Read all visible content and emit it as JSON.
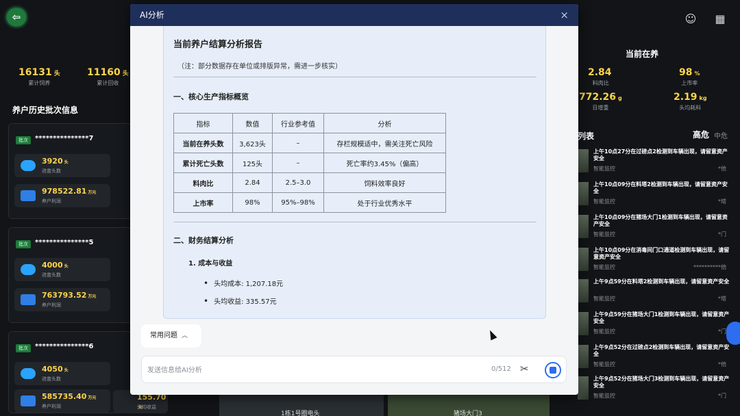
{
  "dashboard": {
    "left_stats": [
      {
        "value": "16131",
        "unit": "头",
        "label": "累计饲养"
      },
      {
        "value": "11160",
        "unit": "头",
        "label": "累计回收"
      }
    ],
    "history_title": "养户历史批次信息",
    "batch_tag": "批次",
    "batches": [
      {
        "name": "***************7",
        "intake": "3920",
        "intake_unit": "头",
        "intake_label": "进苗头数",
        "profit": "978522.81",
        "profit_unit": "万元",
        "profit_label": "养户利润"
      },
      {
        "name": "***************5",
        "intake": "4000",
        "intake_unit": "头",
        "intake_label": "进苗头数",
        "profit": "763793.52",
        "profit_unit": "万元",
        "profit_label": "养户利润"
      },
      {
        "name": "***************6",
        "intake": "4050",
        "intake_unit": "头",
        "intake_label": "进苗头数",
        "profit": "585735.40",
        "profit_unit": "万元",
        "profit_label": "养户利润"
      }
    ],
    "extra_cell": {
      "value": "155.70",
      "unit": "元",
      "label": "头均收益"
    },
    "right_title": "当前在养",
    "right_stats": [
      {
        "value": "2.84",
        "unit": "",
        "label": "料肉比"
      },
      {
        "value": "98",
        "unit": "%",
        "label": "上市率"
      },
      {
        "value": "772.26",
        "unit": "g",
        "label": "日增重"
      },
      {
        "value": "2.19",
        "unit": "kg",
        "label": "头均耗料"
      }
    ],
    "alert_list_title": "列表",
    "level_high": "高危",
    "level_mid": "中危",
    "alerts": [
      {
        "text": "上午10点27分在过磅点2检测到车辆出现，请留意资产安全",
        "source": "智能监控",
        "loc": "*他"
      },
      {
        "text": "上午10点09分在料塔2检测到车辆出现，请留意资产安全",
        "source": "智能监控",
        "loc": "*塔"
      },
      {
        "text": "上午10点09分在猪场大门1检测到车辆出现，请留意资产安全",
        "source": "智能监控",
        "loc": "*门"
      },
      {
        "text": "上午10点09分在消毒间门口通道检测到车辆出现，请留意资产安全",
        "source": "智能监控",
        "loc": "**********他"
      },
      {
        "text": "上午9点59分在料塔2检测到车辆出现，请留意资产安全",
        "source": "智能监控",
        "loc": "*塔"
      },
      {
        "text": "上午9点59分在猪场大门1检测到车辆出现，请留意资产安全",
        "source": "智能监控",
        "loc": "*门"
      },
      {
        "text": "上午9点52分在过磅点2检测到车辆出现，请留意资产安全",
        "source": "智能监控",
        "loc": "*他"
      },
      {
        "text": "上午9点52分在猪场大门3检测到车辆出现，请留意资产安全",
        "source": "智能监控",
        "loc": "*门"
      }
    ],
    "bottom_labels": [
      "1栋1号圈电头",
      "猪场大门3"
    ]
  },
  "modal": {
    "title": "AI分析",
    "close": "×",
    "report": {
      "title": "当前养户结算分析报告",
      "note": "（注：部分数据存在单位或排版异常，需进一步核实）",
      "section1": "一、核心生产指标概览",
      "table": {
        "headers": [
          "指标",
          "数值",
          "行业参考值",
          "分析"
        ],
        "rows": [
          [
            "当前在养头数",
            "3,623头",
            "–",
            "存栏规模适中，需关注死亡风险"
          ],
          [
            "累计死亡头数",
            "125头",
            "–",
            "死亡率约3.45%（偏高）"
          ],
          [
            "料肉比",
            "2.84",
            "2.5–3.0",
            "饲料效率良好"
          ],
          [
            "上市率",
            "98%",
            "95%–98%",
            "处于行业优秀水平"
          ]
        ]
      },
      "section2": "二、财务结算分析",
      "sub1": "1. 成本与收益",
      "bullets": [
        "头均成本: 1,207.18元",
        "头均收益: 335.57元"
      ]
    },
    "faq_label": "常用问题",
    "input_placeholder": "发送信息给AI分析",
    "counter": "0/512"
  }
}
